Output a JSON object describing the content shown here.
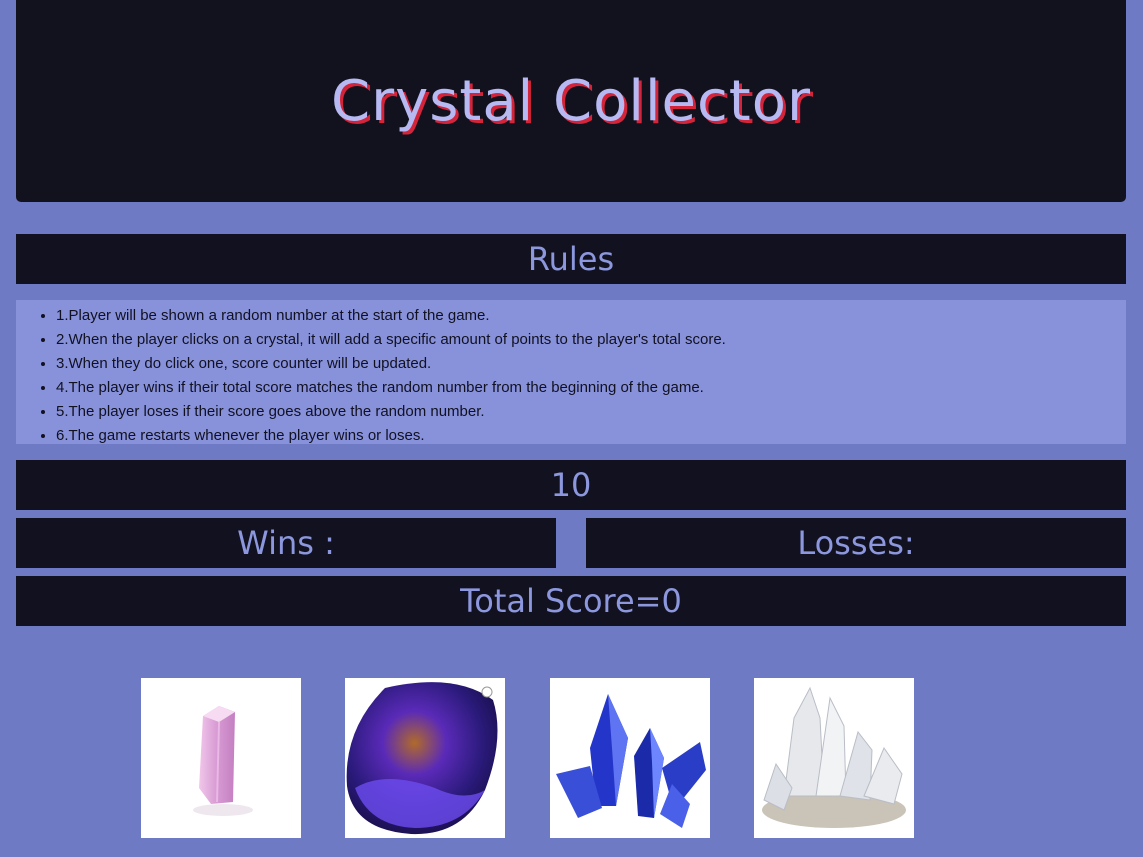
{
  "header": {
    "title": "Crystal Collector"
  },
  "rules": {
    "heading": "Rules",
    "items": [
      "1.Player will be shown a random number at the start of the game.",
      "2.When the player clicks on a crystal, it will add a specific amount of points to the player's total score.",
      "3.When they do click one, score counter will be updated.",
      "4.The player wins if their total score matches the random number from the beginning of the game.",
      "5.The player loses if their score goes above the random number.",
      "6.The game restarts whenever the player wins or loses."
    ]
  },
  "game": {
    "target_number": "10",
    "wins_label": "Wins :",
    "losses_label": "Losses:",
    "total_score_label": "Total Score=0"
  },
  "crystals": [
    {
      "icon": "pink-crystal-icon"
    },
    {
      "icon": "opal-stone-icon"
    },
    {
      "icon": "blue-crystal-icon"
    },
    {
      "icon": "quartz-cluster-icon"
    }
  ],
  "colors": {
    "background": "#6e7bc4",
    "panel": "#11111f",
    "accent_text": "#8c97dd",
    "title_shadow": "#d3243a",
    "rules_bg": "#8892da"
  }
}
